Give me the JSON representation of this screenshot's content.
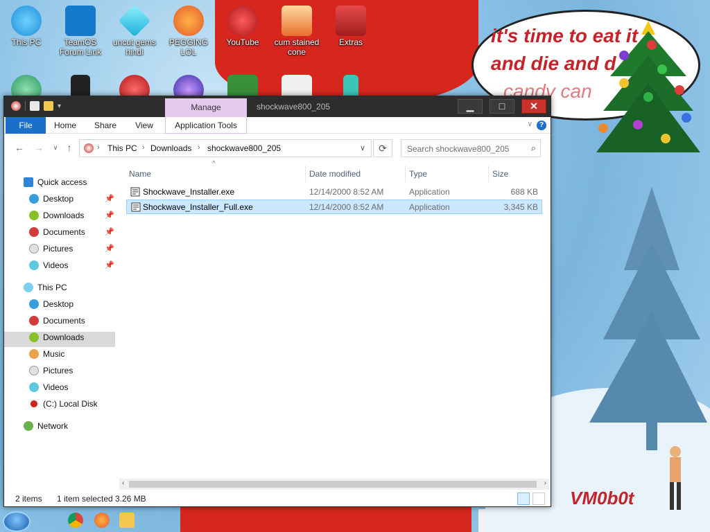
{
  "desktop": {
    "icons": [
      {
        "label": "This PC",
        "icon": "computer-icon",
        "color": "#1d8fd6"
      },
      {
        "label": "TeamOS Forum Link",
        "icon": "gear-icon",
        "color": "#1479c9"
      },
      {
        "label": "uncut gems hindi",
        "icon": "diamond-icon",
        "color": "#2fc4e8"
      },
      {
        "label": "PEGGING LOL",
        "icon": "p-logo-icon",
        "color": "#e3572b"
      },
      {
        "label": "YouTube",
        "icon": "angry-bird-icon",
        "color": "#d6282b"
      },
      {
        "label": "cum stained cone",
        "icon": "cone-icon",
        "color": "#e7702f"
      },
      {
        "label": "Extras",
        "icon": "folder-red-icon",
        "color": "#c82a2a"
      }
    ],
    "speech_lines": [
      "it's time to eat it",
      "and die and d",
      "candy can"
    ],
    "watermark": "VM0b0t"
  },
  "window": {
    "title": "shockwave800_205",
    "manage_tab": "Manage",
    "ribbon_tabs": [
      "File",
      "Home",
      "Share",
      "View",
      "Application Tools"
    ],
    "address": {
      "crumbs": [
        "This PC",
        "Downloads",
        "shockwave800_205"
      ]
    },
    "search_placeholder": "Search shockwave800_205",
    "nav": {
      "quick_access": "Quick access",
      "quick_items": [
        "Desktop",
        "Downloads",
        "Documents",
        "Pictures",
        "Videos"
      ],
      "this_pc": "This PC",
      "pc_items": [
        "Desktop",
        "Documents",
        "Downloads",
        "Music",
        "Pictures",
        "Videos",
        "(C:) Local Disk"
      ],
      "network": "Network",
      "selected": "Downloads"
    },
    "columns": [
      "Name",
      "Date modified",
      "Type",
      "Size"
    ],
    "files": [
      {
        "name": "Shockwave_Installer.exe",
        "date": "12/14/2000 8:52 AM",
        "type": "Application",
        "size": "688 KB",
        "selected": false
      },
      {
        "name": "Shockwave_Installer_Full.exe",
        "date": "12/14/2000 8:52 AM",
        "type": "Application",
        "size": "3,345 KB",
        "selected": true
      }
    ],
    "status": {
      "items": "2 items",
      "selected": "1 item selected",
      "size": "3.26 MB"
    }
  },
  "colors": {
    "accent": "#1a6fc9",
    "selection": "#cce8ff",
    "close": "#c9332b",
    "manage": "#e6c9ee"
  }
}
